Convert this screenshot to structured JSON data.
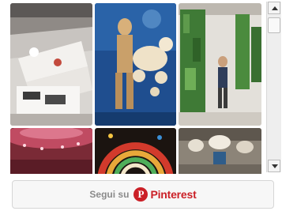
{
  "widget": {
    "follow_prefix": "Segui su",
    "brand_name": "Pinterest",
    "brand_icon_glyph": "P",
    "brand_color": "#cb2027"
  },
  "pins": [
    {
      "name": "pin-image-1",
      "icon": "white-staircase-display-image"
    },
    {
      "name": "pin-image-2",
      "icon": "mannequin-balloon-poodle-image"
    },
    {
      "name": "pin-image-3",
      "icon": "green-plant-wall-image"
    },
    {
      "name": "pin-image-4",
      "icon": "red-ceiling-lights-image"
    },
    {
      "name": "pin-image-5",
      "icon": "colorful-arch-image"
    },
    {
      "name": "pin-image-6",
      "icon": "hanging-installation-image"
    }
  ]
}
